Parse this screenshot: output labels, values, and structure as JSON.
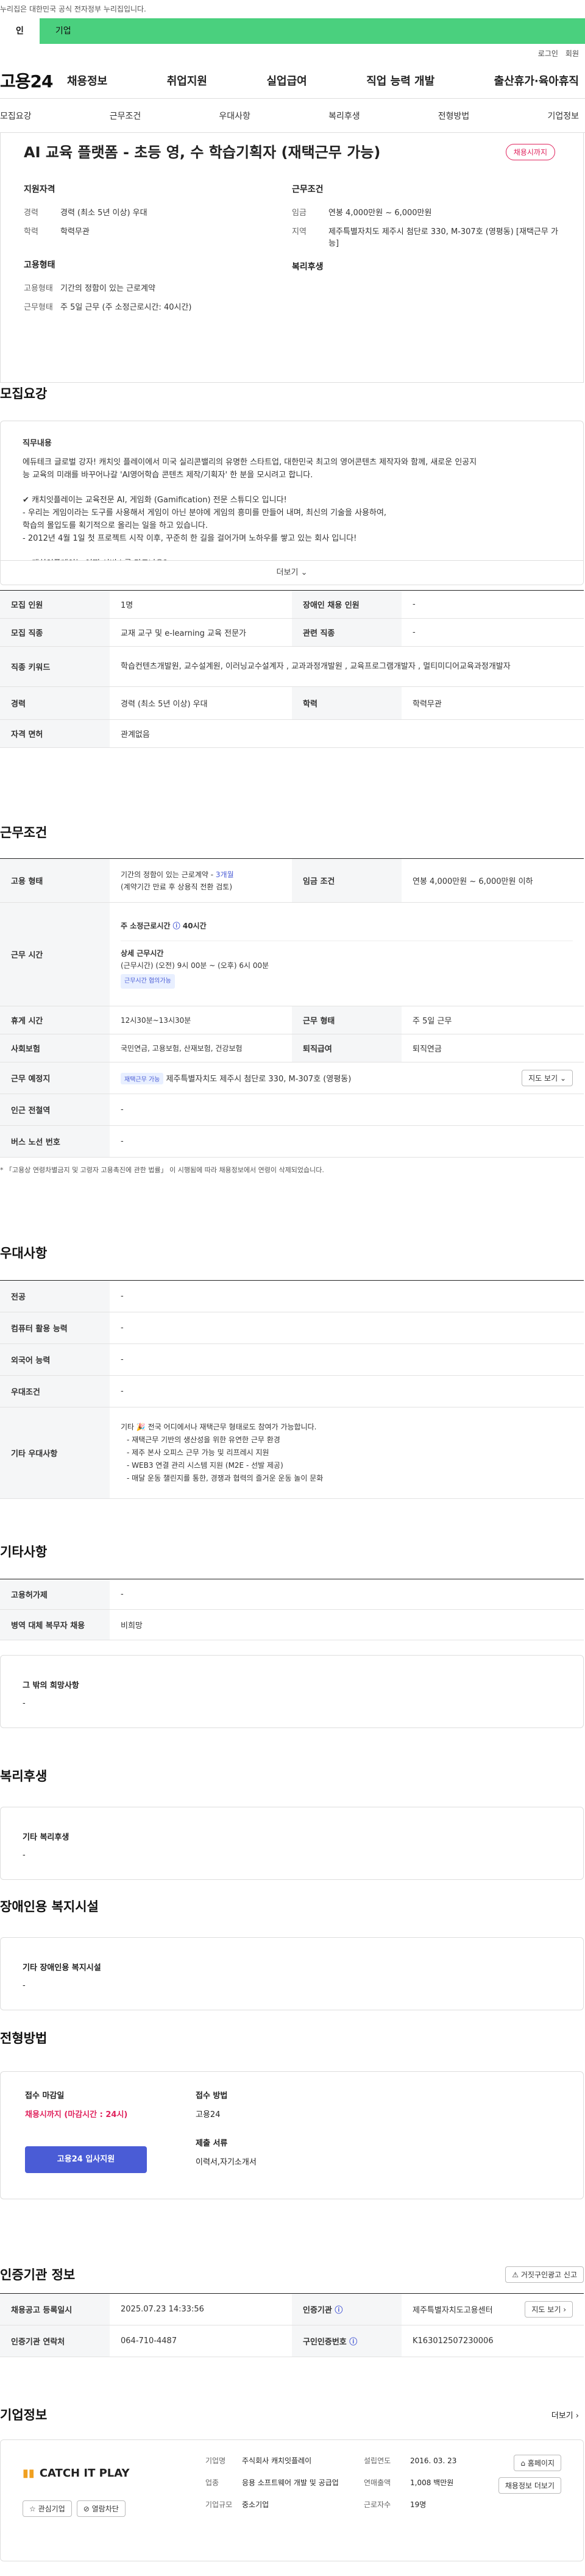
{
  "gov_banner": "누리집은 대한민국 공식 전자정부 누리집입니다.",
  "user_tabs": [
    "인",
    "기업"
  ],
  "util": [
    "로그인",
    "회원"
  ],
  "logo": "고용24",
  "gnb": [
    "채용정보",
    "취업지원",
    "실업급여",
    "직업 능력 개발",
    "출산휴가·육아휴직"
  ],
  "anchors": [
    "모집요강",
    "근무조건",
    "우대사항",
    "복리후생",
    "전형방법",
    "기업정보"
  ],
  "job": {
    "title": "AI 교육 플랫폼 - 초등 영, 수 학습기획자 (재택근무 가능)",
    "badge": "채용시까지",
    "qual_h": "지원자격",
    "exp_k": "경력",
    "exp_v": "경력 (최소 5년 이상) 우대",
    "edu_k": "학력",
    "edu_v": "학력무관",
    "cond_h": "근무조건",
    "wage_k": "임금",
    "wage_v": "연봉 4,000만원 ~ 6,000만원",
    "loc_k": "지역",
    "loc_v": "제주특별자치도 제주시 첨단로 330, M-307호 (영평동) [재택근무 가능]",
    "emp_h": "고용형태",
    "etype_k": "고용형태",
    "etype_v": "기간의 정함이 있는 근로계약",
    "wtype_k": "근무형태",
    "wtype_v": "주 5일 근무 (주 소정근로시간: 40시간)",
    "welfare_h": "복리후생"
  },
  "recruit": {
    "h": "모집요강",
    "duty_h": "직무내용",
    "desc": [
      "에듀테크 글로벌 강자! 캐치잇 플레이에서 미국 실리콘밸리의 유명한 스타트업, 대한민국 최고의 영어콘텐츠 제작자와 함께, 새로운 인공지",
      "능 교육의 미래를 바꾸어나갈 'AI영어학습 콘텐츠 제작/기획자' 한 분을 모시려고 합니다.",
      "✔ 캐치잇플레이는 교육전문 AI, 게임화 (Gamification) 전문 스튜디오 입니다!",
      "- 우리는 게임이라는 도구를 사용해서 게임이 아닌 분야에 게임의 흥미를 만들어 내며, 최신의 기술을 사용하여,",
      "  학습의 몰입도를 획기적으로 올리는 일을 하고 있습니다.",
      "- 2012년 4월 1일 첫 프로젝트 시작 이후, 꾸준히 한 길을 걸어가며 노하우를 쌓고 있는 회사 입니다!",
      "✔ 캐치잇플레이는 어떤 서비스를 만드나요?"
    ],
    "more": "더보기",
    "rows": [
      [
        "모집 인원",
        "1명",
        "장애인 채용 인원",
        "-"
      ],
      [
        "모집 직종",
        "교재 교구 및 e-learning 교육 전문가",
        "관련 직종",
        "-"
      ]
    ],
    "kw_k": "직종 키워드",
    "kw_v": "학습컨텐츠개발원, 교수설계원, 이러닝교수설계자 , 교과과정개발원 , 교육프로그램개발자 , 멀티미디어교육과정개발자",
    "rows2": [
      [
        "경력",
        "경력 (최소 5년 이상) 우대",
        "학력",
        "학력무관"
      ]
    ],
    "lic_k": "자격 면허",
    "lic_v": "관계없음"
  },
  "work": {
    "h": "근무조건",
    "emp_k": "고용 형태",
    "emp_v1": "기간의 정함이 있는 근로계약 - ",
    "emp_months": "3개월",
    "emp_v2": "(계약기간 만료 후 상용직 전환 검토)",
    "wage_k": "임금 조건",
    "wage_v": "연봉 4,000만원 ~ 6,000만원 이하",
    "time_k": "근무 시간",
    "time_main": "주 소정근로시간 ",
    "time_40": "40시간",
    "time_detail_h": "상세 근무시간",
    "time_detail": "(근무시간) (오전) 9시 00분 ~ (오후) 6시 00분",
    "time_chip": "근무시간 협의가능",
    "rest_k": "휴게 시간",
    "rest_v": "12시30분~13시30분",
    "form_k": "근무 형태",
    "form_v": "주 5일 근무",
    "ins_k": "사회보험",
    "ins_v": "국민연금, 고용보험, 산재보험, 건강보험",
    "ret_k": "퇴직급여",
    "ret_v": "퇴직연금",
    "place_k": "근무 예정지",
    "place_chip": "재택근무 가능",
    "place_v": "제주특별자치도 제주시 첨단로 330, M-307호 (영평동)",
    "map": "지도 보기",
    "sub_k": "인근 전철역",
    "sub_v": "-",
    "bus_k": "버스 노선 번호",
    "bus_v": "-",
    "note": "* 「고용상 연령차별금지 및 고령자 고용촉진에 관한 법률」 이 시행됨에 따라 채용정보에서 연령이 삭제되었습니다."
  },
  "pref": {
    "h": "우대사항",
    "rows": [
      [
        "전공",
        "-"
      ],
      [
        "컴퓨터 활용 능력",
        "-"
      ],
      [
        "외국어 능력",
        "-"
      ],
      [
        "우대조건",
        "-"
      ]
    ],
    "etc_k": "기타 우대사항",
    "etc": [
      "기타 🎉 전국 어디에서나 재택근무 형태로도 참여가 가능합니다.",
      "- 재택근무 기반의 생산성을 위한 유연한 근무 환경",
      "- 제주 본사 오피스 근무 가능 및 리프레시 지원",
      "- WEB3 연결 관리 시스템 지원 (M2E - 선발 제공)",
      "- 매달 운동 챌린지를 통한, 경쟁과 협력의 즐거운 운동 놀이 문화"
    ]
  },
  "other": {
    "h": "기타사항",
    "rows": [
      [
        "고용허가제",
        "-"
      ],
      [
        "병역 대체 복무자 채용",
        "비희망"
      ]
    ],
    "hope_h": "그 밖의 희망사항",
    "hope_v": "-"
  },
  "welfare": {
    "h": "복리후생",
    "card_h": "기타 복리후생",
    "card_v": "-"
  },
  "disab": {
    "h": "장애인용 복지시설",
    "card_h": "기타 장애인용 복지시설",
    "card_v": "-"
  },
  "apply": {
    "h": "전형방법",
    "dl_h": "접수 마감일",
    "dl_v": "채용시까지 (마감시간 : 24시)",
    "btn": "고용24 입사지원",
    "method_h": "접수 방법",
    "method_v": "고용24",
    "docs_h": "제출 서류",
    "docs_v": "이력서,자기소개서"
  },
  "agency": {
    "h": "인증기관 정보",
    "report": "거짓구인광고 신고",
    "reg_k": "채용공고 등록일시",
    "reg_v": "2025.07.23 14:33:56",
    "inst_k": "인증기관",
    "inst_v": "제주특별자치도고용센터",
    "map": "지도 보기",
    "tel_k": "인증기관 연락처",
    "tel_v": "064-710-4487",
    "no_k": "구인인증번호",
    "no_v": "K163012507230006"
  },
  "company": {
    "h": "기업정보",
    "more": "더보기",
    "name": "CATCH IT PLAY",
    "fav": "관심기업",
    "block": "열람차단",
    "type_k": "기업명",
    "type_v": "주식회사 캐치잇플레이",
    "ind_k": "업종",
    "ind_v": "응용 소프트웨어 개발 및 공급업",
    "size_k": "기업규모",
    "size_v": "중소기업",
    "est_k": "설립연도",
    "est_v": "2016. 03. 23",
    "sales_k": "연매출액",
    "sales_v": "1,008 백만원",
    "emp_k": "근로자수",
    "emp_v": "19명",
    "home": "홈페이지",
    "list": "채용정보 더보기"
  }
}
